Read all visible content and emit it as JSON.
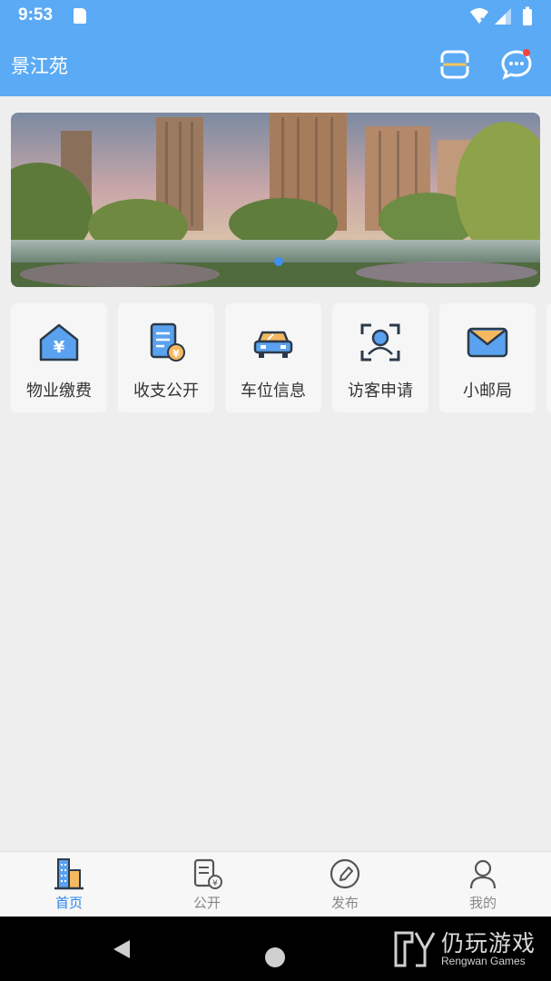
{
  "status_bar": {
    "time": "9:53"
  },
  "app_bar": {
    "title": "景江苑"
  },
  "quick_actions": [
    {
      "label": "物业缴费",
      "icon": "house-yen-icon"
    },
    {
      "label": "收支公开",
      "icon": "document-yen-icon"
    },
    {
      "label": "车位信息",
      "icon": "car-icon"
    },
    {
      "label": "访客申请",
      "icon": "visitor-scan-icon"
    },
    {
      "label": "小邮局",
      "icon": "mail-envelope-icon"
    }
  ],
  "bottom_nav": [
    {
      "label": "首页",
      "icon": "buildings-icon",
      "active": true
    },
    {
      "label": "公开",
      "icon": "document-yen-icon",
      "active": false
    },
    {
      "label": "发布",
      "icon": "pencil-circle-icon",
      "active": false
    },
    {
      "label": "我的",
      "icon": "person-icon",
      "active": false
    }
  ],
  "watermark": {
    "cn": "仍玩游戏",
    "en": "Rengwan Games"
  },
  "colors": {
    "primary": "#5baaf5",
    "active": "#2a86e8",
    "background": "#eeeeee"
  }
}
